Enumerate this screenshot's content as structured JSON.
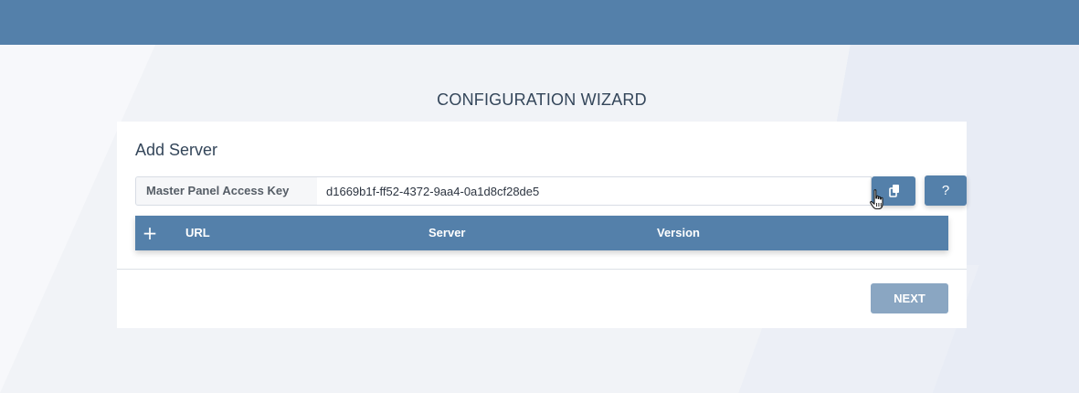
{
  "wizard": {
    "title": "CONFIGURATION WIZARD"
  },
  "card": {
    "title": "Add Server",
    "access_key": {
      "label": "Master Panel Access Key",
      "value": "d1669b1f-ff52-4372-9aa4-0a1d8cf28de5"
    },
    "copy_button_icon": "copy-icon",
    "help_button_label": "?",
    "table": {
      "add_icon": "+",
      "columns": [
        "URL",
        "Server",
        "Version"
      ]
    },
    "next_label": "NEXT"
  },
  "colors": {
    "primary": "#5480aa",
    "disabled_button": "#8aa6c2",
    "title_text": "#34465a"
  }
}
